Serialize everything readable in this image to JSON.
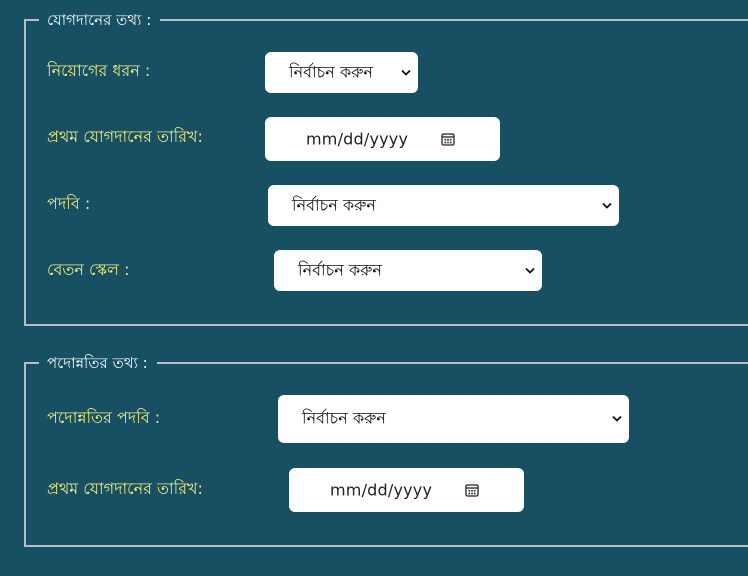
{
  "joining_info": {
    "legend": "যোগদানের তথ্য :",
    "appointment_type": {
      "label": "নিয়োগের ধরন :",
      "selected": "নির্বাচন করুন"
    },
    "first_joining_date": {
      "label": "প্রথম যোগদানের তারিখ:",
      "placeholder": "mm/dd/yyyy"
    },
    "designation": {
      "label": "পদবি :",
      "selected": "নির্বাচন করুন"
    },
    "pay_scale": {
      "label": "বেতন স্কেল :",
      "selected": "নির্বাচন করুন"
    }
  },
  "promotion_info": {
    "legend": "পদোন্নতির তথ্য :",
    "promotion_designation": {
      "label": "পদোন্নতির পদবি :",
      "selected": "নির্বাচন করুন"
    },
    "first_joining_date": {
      "label": "প্রথম যোগদানের তারিখ:",
      "placeholder": "mm/dd/yyyy"
    }
  },
  "icons": {
    "select_arrow": "chevron-down-icon",
    "date_picker": "calendar-icon"
  },
  "colors": {
    "background": "#174f63",
    "label": "#f2ee7a",
    "legend": "#ffffff",
    "border": "#b9bec4",
    "field_bg": "#ffffff"
  }
}
